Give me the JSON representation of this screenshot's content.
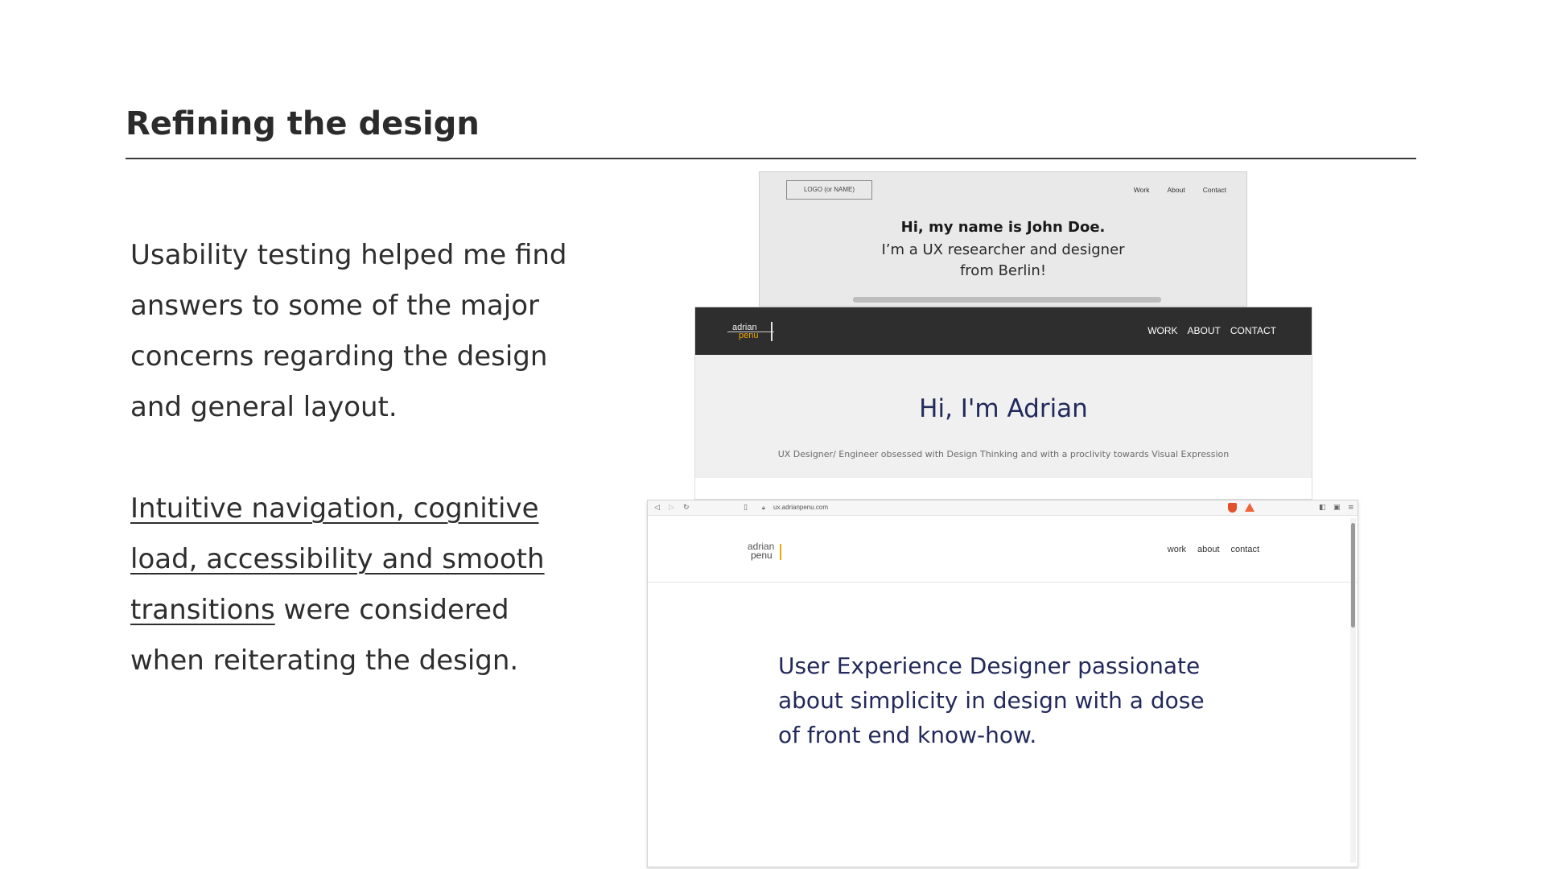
{
  "slide": {
    "title": "Refining the design",
    "para1": "Usability testing helped me find answers to some of the major concerns regarding the design and general layout.",
    "para2_underlined": "Intuitive navigation, cognitive load, accessibility and smooth transitions",
    "para2_rest": " were considered when reiterating the design."
  },
  "wireframe": {
    "logo": "LOGO (or NAME)",
    "nav": [
      "Work",
      "About",
      "Contact"
    ],
    "hello": "Hi, my name is John Doe.",
    "subtitle": "I’m a UX researcher and designer from Berlin!"
  },
  "dark_mockup": {
    "logo_line1": "adrian",
    "logo_line2": "penu",
    "nav": [
      "WORK",
      "ABOUT",
      "CONTACT"
    ],
    "hello": "Hi, I'm Adrian",
    "subtitle": "UX Designer/ Engineer obsessed with Design Thinking and with a proclivity towards Visual Expression"
  },
  "browser_mockup": {
    "url": "ux.adrianpenu.com",
    "logo_line1": "adrian",
    "logo_line2": "penu",
    "nav": [
      "work",
      "about",
      "contact"
    ],
    "hero": "User Experience Designer passionate about simplicity in design with a dose of front end know-how.",
    "icons": [
      "back-icon",
      "forward-icon",
      "reload-icon",
      "bookmark-icon",
      "lock-icon",
      "brave-shield-icon",
      "alert-icon",
      "sidebar-icon",
      "wallet-icon",
      "menu-icon"
    ]
  },
  "colors": {
    "accent": "#f0a800",
    "hero_text": "#23295a",
    "dark_header": "#2e2e2e"
  }
}
